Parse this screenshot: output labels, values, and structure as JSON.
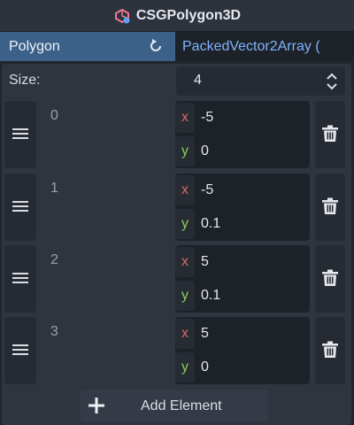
{
  "header": {
    "title": "CSGPolygon3D",
    "icon": "csg-polygon-node-icon"
  },
  "property": {
    "label": "Polygon",
    "revert_icon": "revert-icon",
    "value": "PackedVector2Array ("
  },
  "size": {
    "label": "Size:",
    "value": "4"
  },
  "elements": [
    {
      "index": "0",
      "x_label": "x",
      "x": "-5",
      "y_label": "y",
      "y": "0"
    },
    {
      "index": "1",
      "x_label": "x",
      "x": "-5",
      "y_label": "y",
      "y": "0.1"
    },
    {
      "index": "2",
      "x_label": "x",
      "x": "5",
      "y_label": "y",
      "y": "0.1"
    },
    {
      "index": "3",
      "x_label": "x",
      "x": "5",
      "y_label": "y",
      "y": "0"
    }
  ],
  "add_button": {
    "label": "Add Element",
    "icon": "plus-icon"
  },
  "colors": {
    "accent": "#3b6189",
    "x_axis": "#d96a6a",
    "y_axis": "#8ccf5c",
    "link_value": "#7fb3ff"
  }
}
